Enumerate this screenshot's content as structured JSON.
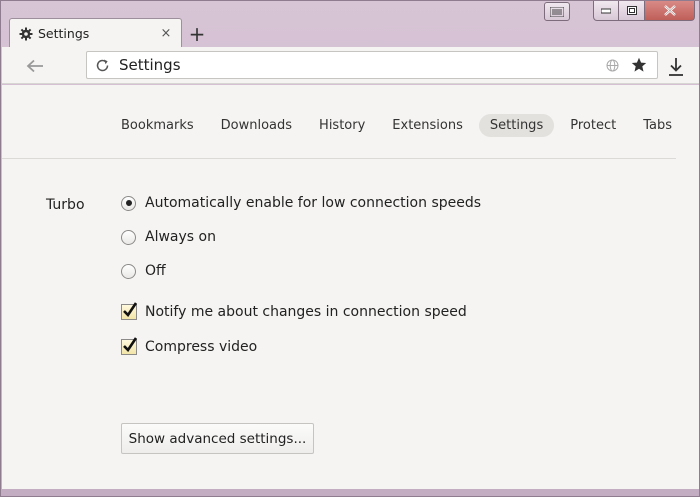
{
  "tab": {
    "title": "Settings",
    "close_glyph": "×",
    "icon": "gear-icon"
  },
  "newtab_glyph": "+",
  "omnibox": {
    "url": "Settings"
  },
  "nav": {
    "tabs": [
      {
        "label": "Bookmarks"
      },
      {
        "label": "Downloads"
      },
      {
        "label": "History"
      },
      {
        "label": "Extensions"
      },
      {
        "label": "Settings",
        "active": true
      },
      {
        "label": "Protect"
      },
      {
        "label": "Tabs on othe"
      }
    ]
  },
  "turbo": {
    "label": "Turbo",
    "options": [
      {
        "label": "Automatically enable for low connection speeds",
        "selected": true
      },
      {
        "label": "Always on",
        "selected": false
      },
      {
        "label": "Off",
        "selected": false
      }
    ],
    "checkboxes": [
      {
        "label": "Notify me about changes in connection speed",
        "checked": true
      },
      {
        "label": "Compress video",
        "checked": true
      }
    ]
  },
  "advanced_button": "Show advanced settings...",
  "colors": {
    "window_frame": "#cbb6ca",
    "content_bg": "#f5f4f2",
    "close_button": "#c05f59",
    "checkbox_fill": "#f2e5a8"
  }
}
